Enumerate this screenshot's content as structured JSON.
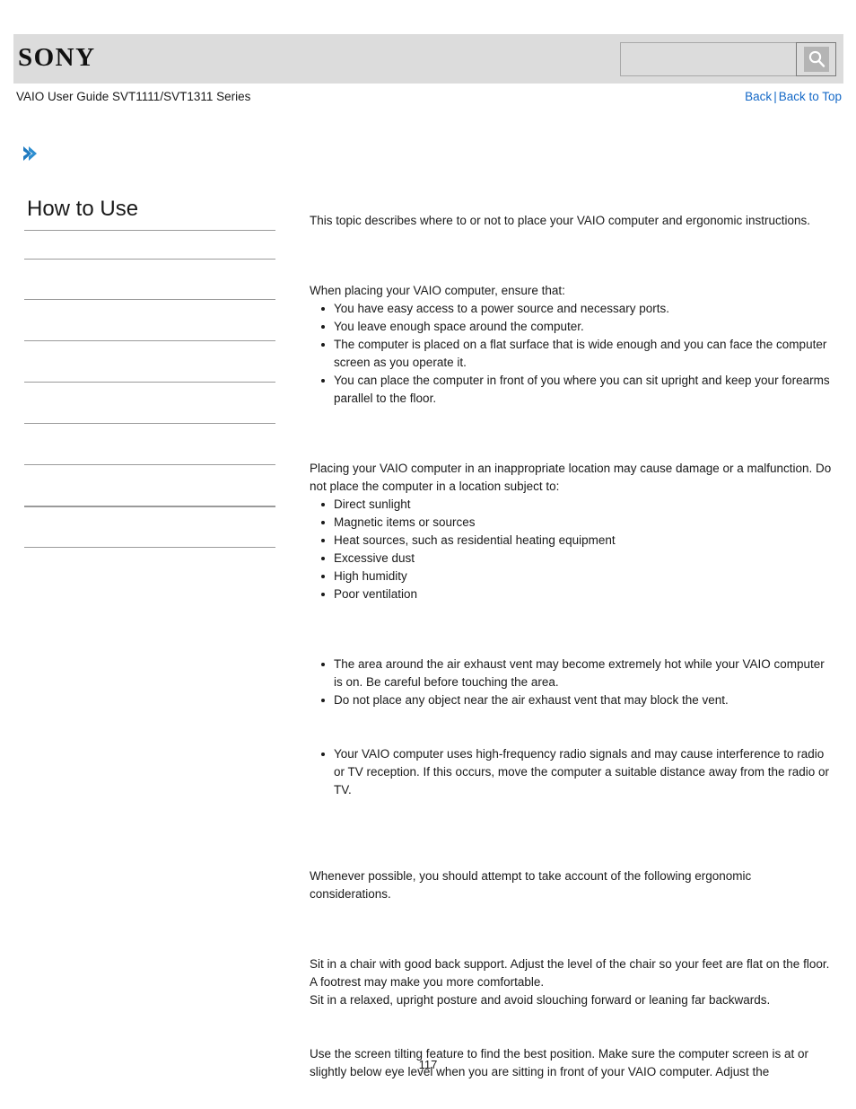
{
  "header": {
    "logo_text": "SONY",
    "search": {
      "value": "",
      "placeholder": "",
      "icon": "search-icon"
    }
  },
  "subheader": {
    "guide_title": "VAIO User Guide SVT1111/SVT1311 Series",
    "back_label": "Back",
    "separator": "|",
    "back_to_top_label": "Back to Top"
  },
  "breadcrumb": {
    "icon": "chevron-right-icon",
    "icon_color": "#1f7ac0",
    "text": ""
  },
  "sidebar": {
    "title": "How to Use",
    "items": [
      {
        "label": ""
      },
      {
        "label": ""
      },
      {
        "label": ""
      },
      {
        "label": ""
      },
      {
        "label": ""
      },
      {
        "label": ""
      },
      {
        "label": ""
      },
      {
        "label": ""
      },
      {
        "label": ""
      }
    ]
  },
  "main": {
    "intro": "This topic describes where to or not to place your VAIO computer and ergonomic instructions.",
    "sections": [
      {
        "heading": "",
        "paragraph": "When placing your VAIO computer, ensure that:",
        "bullets": [
          "You have easy access to a power source and necessary ports.",
          "You leave enough space around the computer.",
          "The computer is placed on a flat surface that is wide enough and you can face the computer screen as you operate it.",
          "You can place the computer in front of you where you can sit upright and keep your forearms parallel to the floor."
        ]
      },
      {
        "heading": "",
        "paragraph": "Placing your VAIO computer in an inappropriate location may cause damage or a malfunction. Do not place the computer in a location subject to:",
        "bullets": [
          "Direct sunlight",
          "Magnetic items or sources",
          "Heat sources, such as residential heating equipment",
          "Excessive dust",
          "High humidity",
          "Poor ventilation"
        ]
      },
      {
        "heading": "",
        "paragraph": "",
        "bullets": [
          "The area around the air exhaust vent may become extremely hot while your VAIO computer is on. Be careful before touching the area.",
          "Do not place any object near the air exhaust vent that may block the vent."
        ]
      },
      {
        "heading": "",
        "paragraph": "",
        "bullets": [
          "Your VAIO computer uses high-frequency radio signals and may cause interference to radio or TV reception. If this occurs, move the computer a suitable distance away from the radio or TV."
        ]
      }
    ],
    "ergonomic_intro": "Whenever possible, you should attempt to take account of the following ergonomic considerations.",
    "ergonomic_blocks": [
      {
        "heading": "",
        "lines": [
          "Sit in a chair with good back support. Adjust the level of the chair so your feet are flat on the floor. A footrest may make you more comfortable.",
          "Sit in a relaxed, upright posture and avoid slouching forward or leaning far backwards."
        ]
      },
      {
        "heading": "",
        "lines": [
          "Use the screen tilting feature to find the best position. Make sure the computer screen is at or slightly below eye level when you are sitting in front of your VAIO computer. Adjust the"
        ]
      }
    ]
  },
  "footer": {
    "page_number": "117"
  }
}
